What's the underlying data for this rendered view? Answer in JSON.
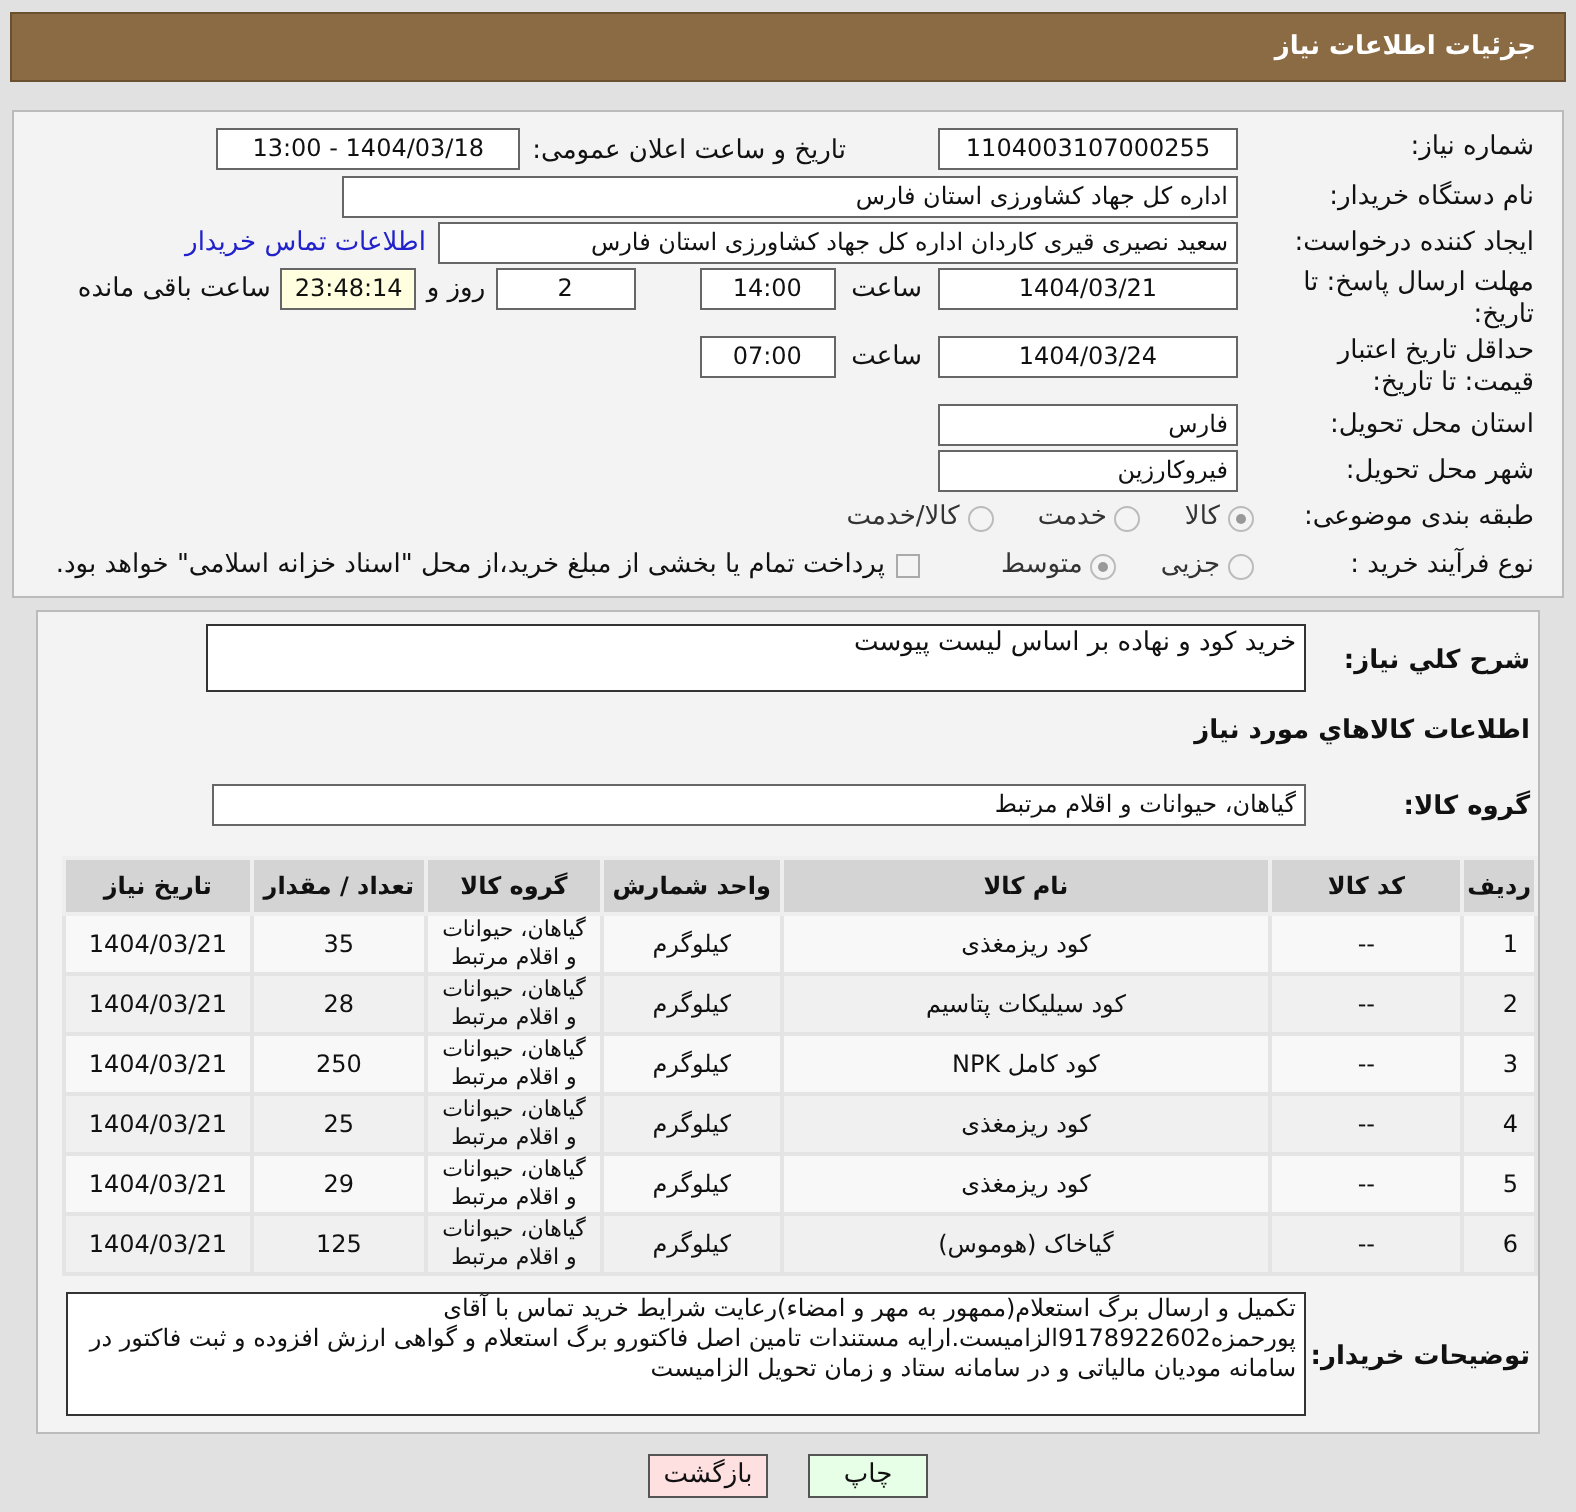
{
  "header": {
    "title": "جزئیات اطلاعات نیاز"
  },
  "need_number": {
    "label": "شماره نیاز:",
    "value": "1104003107000255"
  },
  "announce": {
    "label": "تاریخ و ساعت اعلان عمومی:",
    "value": "1404/03/18 - 13:00"
  },
  "buyer_org": {
    "label": "نام دستگاه خریدار:",
    "value": "اداره کل جهاد کشاورزی استان فارس"
  },
  "requester": {
    "label": "ایجاد کننده درخواست:",
    "value": "سعید نصیری قیری کاردان اداره کل جهاد کشاورزی استان فارس",
    "link": "اطلاعات تماس خریدار"
  },
  "deadline": {
    "label": "مهلت ارسال پاسخ: تا تاریخ:",
    "date": "1404/03/21",
    "time_label": "ساعت",
    "time": "14:00",
    "days": "2",
    "days_label": "روز و",
    "remaining": "23:48:14",
    "remaining_label": "ساعت باقی مانده"
  },
  "validity": {
    "label": "حداقل تاریخ اعتبار قیمت: تا تاریخ:",
    "date": "1404/03/24",
    "time_label": "ساعت",
    "time": "07:00"
  },
  "province": {
    "label": "استان محل تحویل:",
    "value": "فارس"
  },
  "city": {
    "label": "شهر محل تحویل:",
    "value": "فیروکارزین"
  },
  "category": {
    "label": "طبقه بندی موضوعی:",
    "options": [
      {
        "label": "کالا",
        "selected": true
      },
      {
        "label": "خدمت",
        "selected": false
      },
      {
        "label": "کالا/خدمت",
        "selected": false
      }
    ]
  },
  "process": {
    "label": "نوع فرآیند خرید :",
    "options": [
      {
        "label": "جزیی",
        "selected": false
      },
      {
        "label": "متوسط",
        "selected": true
      }
    ],
    "treasury": {
      "label": "پرداخت تمام یا بخشی از مبلغ خرید،از محل \"اسناد خزانه اسلامی\" خواهد بود.",
      "checked": false
    }
  },
  "description": {
    "label": "شرح کلي نياز:",
    "value": "خرید کود و نهاده بر اساس لیست پیوست"
  },
  "goods_heading": "اطلاعات کالاهاي مورد نياز",
  "goods_group": {
    "label": "گروه کالا:",
    "value": "گیاهان، حیوانات و اقلام مرتبط"
  },
  "table": {
    "columns": [
      "ردیف",
      "کد کالا",
      "نام کالا",
      "واحد شمارش",
      "گروه کالا",
      "تعداد / مقدار",
      "تاریخ نیاز"
    ],
    "rows": [
      [
        "1",
        "--",
        "کود ریزمغذی",
        "کیلوگرم",
        "گیاهان، حیوانات و اقلام مرتبط",
        "35",
        "1404/03/21"
      ],
      [
        "2",
        "--",
        "کود سیلیکات پتاسیم",
        "کیلوگرم",
        "گیاهان، حیوانات و اقلام مرتبط",
        "28",
        "1404/03/21"
      ],
      [
        "3",
        "--",
        "کود کامل NPK",
        "کیلوگرم",
        "گیاهان، حیوانات و اقلام مرتبط",
        "250",
        "1404/03/21"
      ],
      [
        "4",
        "--",
        "کود ریزمغذی",
        "کیلوگرم",
        "گیاهان، حیوانات و اقلام مرتبط",
        "25",
        "1404/03/21"
      ],
      [
        "5",
        "--",
        "کود ریزمغذی",
        "کیلوگرم",
        "گیاهان، حیوانات و اقلام مرتبط",
        "29",
        "1404/03/21"
      ],
      [
        "6",
        "--",
        "گیاخاک (هوموس)",
        "کیلوگرم",
        "گیاهان، حیوانات و اقلام مرتبط",
        "125",
        "1404/03/21"
      ]
    ]
  },
  "buyer_notes": {
    "label": "توضیحات خریدار:",
    "value": "تکمیل و ارسال برگ استعلام(ممهور به مهر و امضاء)رعایت شرایط خرید تماس با آقای پورحمزه9178922602الزامیست.ارایه مستندات تامین اصل فاکتورو برگ استعلام و گواهی ارزش افزوده و ثبت فاکتور در سامانه مودیان مالیاتی و در سامانه ستاد و زمان تحویل الزامیست"
  },
  "buttons": [
    {
      "label": "چاپ",
      "kind": "print"
    },
    {
      "label": "بازگشت",
      "kind": "back"
    }
  ]
}
